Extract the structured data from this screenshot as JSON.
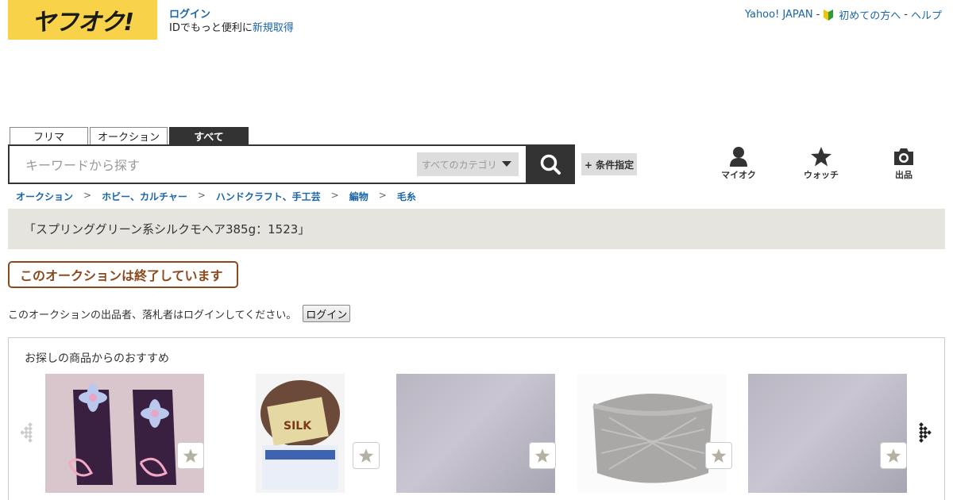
{
  "header": {
    "logo_text": "ヤフオク!",
    "login_label": "ログイン",
    "login_sub_prefix": "IDでもっと便利に",
    "register_label": "新規取得",
    "top_links": {
      "yahoo_japan": "Yahoo! JAPAN",
      "sep1": "-",
      "beginner": "初めての方へ",
      "sep2": "-",
      "help": "ヘルプ"
    }
  },
  "search": {
    "tabs": [
      "フリマ",
      "オークション",
      "すべて"
    ],
    "active_tab": "すべて",
    "placeholder": "キーワードから探す",
    "category_value": "すべてのカテゴリ",
    "condition_label": "+ 条件指定"
  },
  "right_nav": {
    "myauc": "マイオク",
    "watch": "ウォッチ",
    "sell": "出品"
  },
  "breadcrumb": [
    "オークション",
    "ホビー、カルチャー",
    "ハンドクラフト、手工芸",
    "編物",
    "毛糸"
  ],
  "breadcrumb_sep": ">",
  "item_title": "「スプリンググリーン系シルクモヘア385g：1523」",
  "closed_notice": "このオークションは終了しています",
  "login_notice": {
    "text": "このオークションの出品者、落札者はログインしてください。",
    "button": "ログイン"
  },
  "recommendations": {
    "title": "お探しの商品からのおすすめ",
    "items": [
      {
        "image": "purple knitted arm warmers with flowers"
      },
      {
        "image": "brown silk yarn ball with label",
        "label_text": "SILK"
      },
      {
        "image": "lavender grey yarn cone close-up"
      },
      {
        "image": "grey yarn cone"
      },
      {
        "image": "lavender grey yarn cone close-up"
      }
    ]
  },
  "colors": {
    "logo_bg": "#f8d34a",
    "link": "#1a65a8",
    "title_band": "#e5e4df",
    "closed_border": "#8b4a1e",
    "dark": "#333333"
  }
}
